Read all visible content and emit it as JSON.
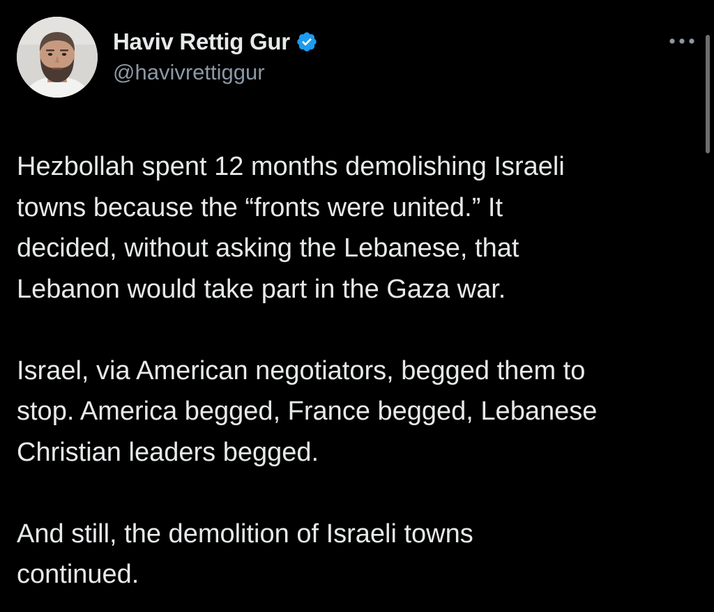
{
  "author": {
    "display_name": "Haviv Rettig Gur",
    "handle": "@havivrettiggur",
    "verified": true,
    "verified_icon": "verified-badge-icon",
    "verified_color": "#1d9bf0"
  },
  "tweet": {
    "paragraphs": [
      "Hezbollah spent 12 months demolishing Israeli\ntowns because the “fronts were united.” It\ndecided, without asking the Lebanese, that\nLebanon would take part in the Gaza war.",
      "Israel, via American negotiators, begged them to\nstop. America begged, France begged, Lebanese\nChristian leaders begged.",
      "And still, the demolition of Israeli towns\ncontinued."
    ]
  },
  "icons": {
    "more": "more-horizontal-icon",
    "avatar": "avatar"
  },
  "colors": {
    "background": "#000000",
    "text": "#e7e9ea",
    "secondary_text": "#8b98a5",
    "accent": "#1d9bf0"
  }
}
